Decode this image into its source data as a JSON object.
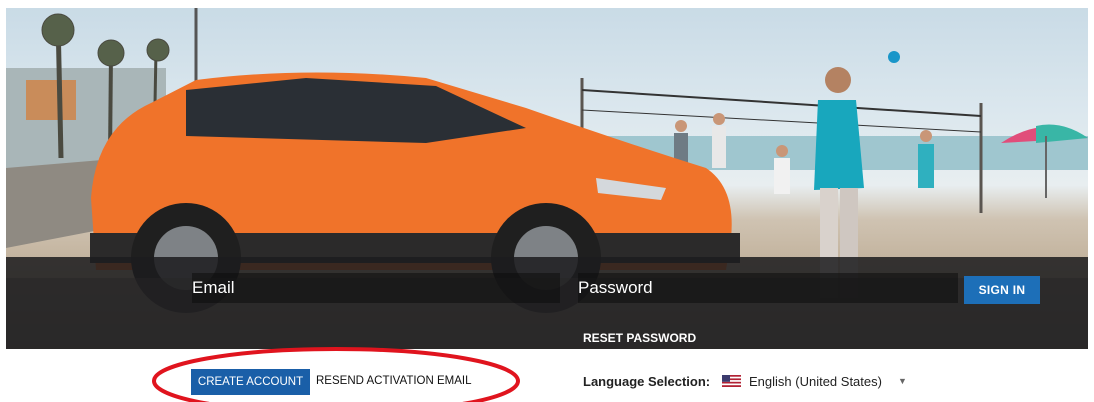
{
  "login": {
    "email_placeholder": "Email",
    "password_placeholder": "Password",
    "signin_label": "SIGN IN",
    "reset_password_label": "RESET PASSWORD"
  },
  "account": {
    "create_account_label": "CREATE ACCOUNT",
    "resend_activation_label": "RESEND ACTIVATION EMAIL"
  },
  "language": {
    "label": "Language Selection:",
    "selected": "English (United States)",
    "flag_icon": "us-flag-icon",
    "dropdown_icon": "chevron-down-icon"
  },
  "colors": {
    "signin_button": "#1d6fb8",
    "create_account_button": "#1a5fa8",
    "annotation_circle": "#e0141e",
    "car_body": "#f0732a",
    "login_bar": "#1c1c1e"
  },
  "annotation": {
    "shape": "ellipse",
    "color": "#e0141e"
  }
}
